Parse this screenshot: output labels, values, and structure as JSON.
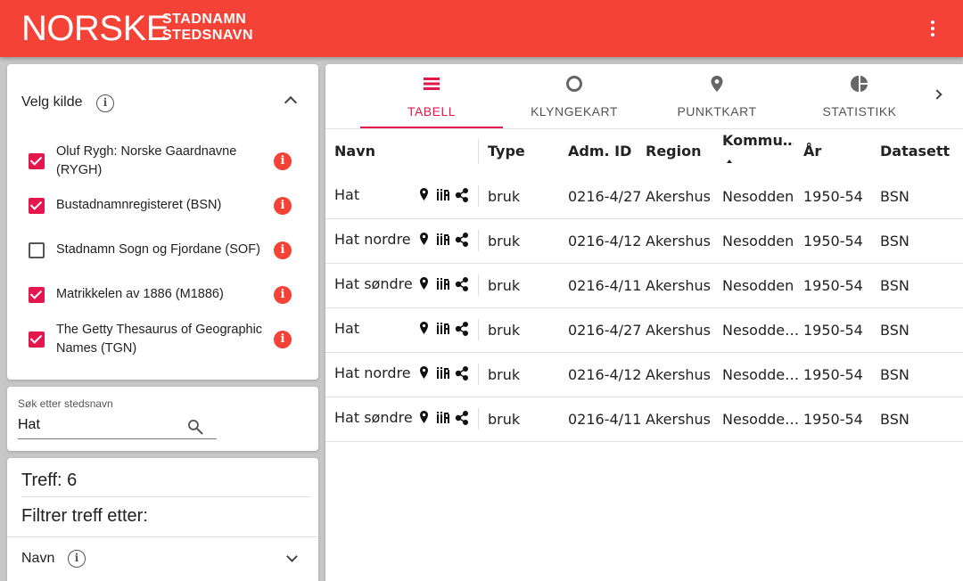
{
  "header": {
    "logo_main": "NORSKE",
    "logo_line1": "STADNAMN",
    "logo_line2": "STEDSNAVN",
    "menu_icon": "more-vert-icon"
  },
  "sources": {
    "title": "Velg kilde",
    "items": [
      {
        "label": "Oluf Rygh: Norske Gaardnavne (RYGH)",
        "checked": true
      },
      {
        "label": "Bustadnamnregisteret (BSN)",
        "checked": true
      },
      {
        "label": "Stadnamn Sogn og Fjordane (SOF)",
        "checked": false
      },
      {
        "label": "Matrikkelen av 1886 (M1886)",
        "checked": true
      },
      {
        "label": "The Getty Thesaurus of Geographic Names (TGN)",
        "checked": true
      }
    ]
  },
  "search": {
    "label": "Søk etter stedsnavn",
    "value": "Hat"
  },
  "filter": {
    "treff": "Treff: 6",
    "title": "Filtrer treff etter:",
    "navn_label": "Navn"
  },
  "tabs": [
    {
      "label": "TABELL",
      "icon": "table-icon",
      "active": true
    },
    {
      "label": "KLYNGEKART",
      "icon": "circle-icon",
      "active": false
    },
    {
      "label": "PUNKTKART",
      "icon": "map-pin-icon",
      "active": false
    },
    {
      "label": "STATISTIKK",
      "icon": "pie-chart-icon",
      "active": false
    }
  ],
  "table": {
    "headers": {
      "navn": "Navn",
      "type": "Type",
      "adm_id": "Adm. ID",
      "region": "Region",
      "kommune": "Kommu…",
      "aar": "År",
      "datasett": "Datasett"
    },
    "rows": [
      {
        "navn": "Hat",
        "type": "bruk",
        "adm_id": "0216-4/27",
        "region": "Akershus",
        "kommune": "Nesodden",
        "aar": "1950-54",
        "datasett": "BSN"
      },
      {
        "navn": "Hat nordre",
        "type": "bruk",
        "adm_id": "0216-4/12",
        "region": "Akershus",
        "kommune": "Nesodden",
        "aar": "1950-54",
        "datasett": "BSN"
      },
      {
        "navn": "Hat søndre",
        "type": "bruk",
        "adm_id": "0216-4/11",
        "region": "Akershus",
        "kommune": "Nesodden",
        "aar": "1950-54",
        "datasett": "BSN"
      },
      {
        "navn": "Hat",
        "type": "bruk",
        "adm_id": "0216-4/27",
        "region": "Akershus",
        "kommune": "Nesodde…",
        "aar": "1950-54",
        "datasett": "BSN"
      },
      {
        "navn": "Hat nordre",
        "type": "bruk",
        "adm_id": "0216-4/12",
        "region": "Akershus",
        "kommune": "Nesodde…",
        "aar": "1950-54",
        "datasett": "BSN"
      },
      {
        "navn": "Hat søndre",
        "type": "bruk",
        "adm_id": "0216-4/11",
        "region": "Akershus",
        "kommune": "Nesodde…",
        "aar": "1950-54",
        "datasett": "BSN"
      }
    ]
  },
  "colors": {
    "header_red": "#f44336",
    "accent_pink": "#e5164d"
  }
}
